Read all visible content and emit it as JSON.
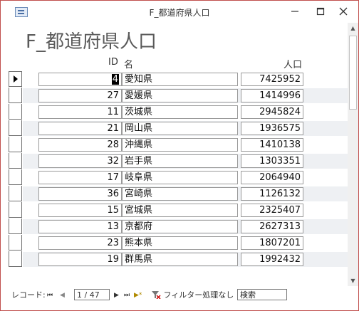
{
  "window": {
    "title": "F_都道府県人口"
  },
  "form": {
    "title": "F_都道府県人口",
    "columns": {
      "id": "ID",
      "name": "名",
      "population": "人口"
    },
    "rows": [
      {
        "id": "4",
        "name": "愛知県",
        "population": "7425952"
      },
      {
        "id": "27",
        "name": "愛媛県",
        "population": "1414996"
      },
      {
        "id": "11",
        "name": "茨城県",
        "population": "2945824"
      },
      {
        "id": "21",
        "name": "岡山県",
        "population": "1936575"
      },
      {
        "id": "28",
        "name": "沖縄県",
        "population": "1410138"
      },
      {
        "id": "32",
        "name": "岩手県",
        "population": "1303351"
      },
      {
        "id": "17",
        "name": "岐阜県",
        "population": "2064940"
      },
      {
        "id": "36",
        "name": "宮崎県",
        "population": "1126132"
      },
      {
        "id": "15",
        "name": "宮城県",
        "population": "2325407"
      },
      {
        "id": "13",
        "name": "京都府",
        "population": "2627313"
      },
      {
        "id": "23",
        "name": "熊本県",
        "population": "1807201"
      },
      {
        "id": "19",
        "name": "群馬県",
        "population": "1992432"
      }
    ]
  },
  "navbar": {
    "record_label": "レコード:",
    "record_value": "1 / 47",
    "filter_label": "フィルター処理なし",
    "search_label": "検索"
  },
  "icons": {
    "first": "⏮",
    "prev": "◀",
    "next": "▶",
    "last": "⏭",
    "new": "▶*"
  }
}
